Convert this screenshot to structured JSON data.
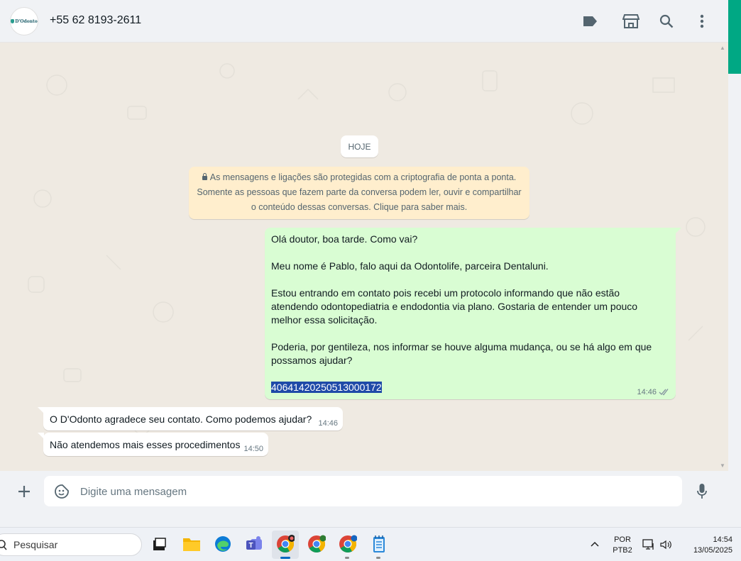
{
  "header": {
    "avatar_text": "D'Odonto",
    "contact_name": "+55 62 8193-2611",
    "icons": [
      "label-icon",
      "catalog-icon",
      "search-icon",
      "menu-icon"
    ]
  },
  "chat": {
    "date_chip": "HOJE",
    "encryption_notice": {
      "line1": "As mensagens e ligações são protegidas com a criptografia de ponta a ponta.",
      "line2": "Somente as pessoas que fazem parte da conversa podem ler, ouvir e compartilhar",
      "line3": "o conteúdo dessas conversas. Clique para saber mais."
    },
    "outgoing": {
      "p1": "Olá doutor, boa tarde. Como vai?",
      "p2": "Meu nome é Pablo, falo aqui da Odontolife, parceira Dentaluni.",
      "p3": "Estou entrando em contato pois recebi um protocolo informando que não estão atendendo odontopediatria e endodontia via plano. Gostaria de entender um pouco melhor essa solicitação.",
      "p4": "Poderia, por gentileza, nos informar se houve alguma mudança, ou se há algo em que possamos ajudar?",
      "protocol": "40641420250513000172",
      "time": "14:46",
      "status": "read"
    },
    "incoming": [
      {
        "text": "O D'Odonto agradece seu contato. Como podemos ajudar?",
        "time": "14:46"
      },
      {
        "text": "Não atendemos mais esses procedimentos",
        "time": "14:50"
      }
    ]
  },
  "composer": {
    "placeholder": "Digite uma mensagem"
  },
  "taskbar": {
    "search_label": "Pesquisar",
    "apps": [
      "task-view",
      "file-explorer",
      "edge",
      "teams",
      "chrome-profile-1",
      "chrome-profile-2",
      "chrome-profile-3",
      "notepad"
    ],
    "language_line1": "POR",
    "language_line2": "PTB2",
    "clock_time": "14:54",
    "clock_date": "13/05/2025"
  },
  "colors": {
    "accent": "#00a884",
    "outgoing_bubble": "#d9fdd3",
    "incoming_bubble": "#ffffff",
    "notice": "#ffeecd",
    "selection": "#1f4aa8",
    "read_ticks": "#8696a0"
  }
}
